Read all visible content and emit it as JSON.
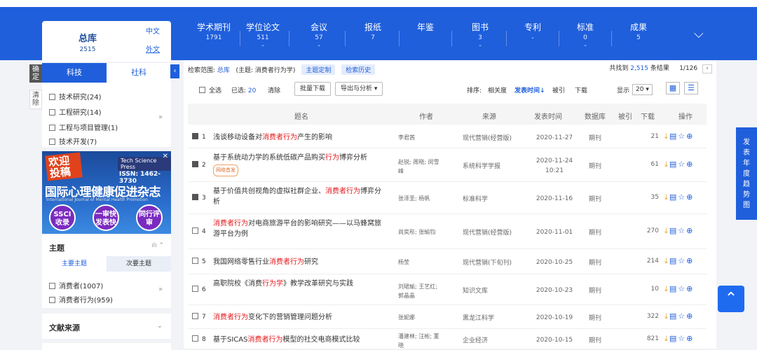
{
  "left_toggle": [
    "确定",
    "清除"
  ],
  "library": {
    "title": "总库",
    "count": "2515",
    "lang_zh": "中文",
    "lang_en": "外文"
  },
  "nav_tabs": [
    {
      "label": "学术期刊",
      "count": "1791",
      "caret": ""
    },
    {
      "label": "学位论文",
      "count": "511",
      "caret": "⌄"
    },
    {
      "label": "会议",
      "count": "57",
      "caret": "⌄"
    },
    {
      "label": "报纸",
      "count": "7",
      "caret": ""
    },
    {
      "label": "年鉴",
      "count": "",
      "caret": ""
    },
    {
      "label": "图书",
      "count": "3",
      "caret": "⌄"
    },
    {
      "label": "专利",
      "count": "",
      "caret": "⌄"
    },
    {
      "label": "标准",
      "count": "0",
      "caret": "⌄"
    },
    {
      "label": "成果",
      "count": "5",
      "caret": ""
    }
  ],
  "filter": {
    "tab_active": "科技",
    "tab_inactive": "社科",
    "items": [
      "技术研究(24)",
      "工程研究(14)",
      "工程与项目管理(1)",
      "技术开发(7)"
    ]
  },
  "ad": {
    "line1": "欢迎投稿",
    "press": "Tech Science Press",
    "issn": "ISSN: 1462-3730",
    "title": "国际心理健康促进杂志",
    "subtitle": "International Journal of Mental Health Promotion",
    "badges": [
      "SSCI收录",
      "一审快发表快",
      "同行评审"
    ]
  },
  "subject": {
    "heading": "主题",
    "tab_main": "主要主题",
    "tab_sub": "次要主题",
    "items": [
      "消费者(1007)",
      "消费者行为(959)"
    ]
  },
  "source": {
    "heading": "文献来源"
  },
  "scope": {
    "label": "检索范围:",
    "db": "总库",
    "query": "(主题: 消费者行为学)",
    "custom": "主题定制",
    "history": "检索历史"
  },
  "found": {
    "prefix": "共找到",
    "count": "2,515",
    "suffix": "条结果",
    "page": "1/126"
  },
  "toolbar": {
    "select_all": "全选",
    "selected_label": "已选:",
    "selected_count": "20",
    "clear": "清除",
    "batch": "批量下载",
    "export": "导出与分析 ▾",
    "sort_label": "排序:",
    "sort_rel": "相关度",
    "sort_time": "发表时间↓",
    "sort_cite": "被引",
    "sort_dl": "下载",
    "show_label": "显示",
    "show_value": "20 ▾"
  },
  "headers": {
    "title": "题名",
    "author": "作者",
    "source": "来源",
    "date": "发表时间",
    "db": "数据库",
    "cite": "被引",
    "dl": "下载",
    "ops": "操作"
  },
  "rows": [
    {
      "num": "1",
      "checked": true,
      "t1": "浅谈移动设备对",
      "hl": "消费者行为",
      "t2": "产生的影响",
      "tag": "",
      "author": "李君茜",
      "source": "现代营销(经营版)",
      "date": "2020-11-27",
      "db": "期刊",
      "dl": "21"
    },
    {
      "num": "2",
      "checked": true,
      "t1": "基于系统动力学的系统低碳产品购买",
      "hl": "行为",
      "t2": "博弈分析",
      "tag": "网络首发",
      "author": "赵锐; 周晓; 闵雪峰",
      "source": "系统科学学报",
      "date": "2020-11-24 10:21",
      "db": "期刊",
      "dl": "61"
    },
    {
      "num": "3",
      "checked": true,
      "t1": "基于价值共创视角的虚拟社群企业、",
      "hl": "消费者行为",
      "t2": "博弈分析",
      "tag": "",
      "author": "张泽圣; 杨帆",
      "source": "标准科学",
      "date": "2020-11-16",
      "db": "期刊",
      "dl": "35"
    },
    {
      "num": "4",
      "checked": false,
      "t1": "",
      "hl": "消费者行为",
      "t2": "对电商旅游平台的影响研究——以马蜂窝旅游平台为例",
      "tag": "",
      "author": "尚奕彤; 张瑜钧",
      "source": "现代营销(经营版)",
      "date": "2020-11-01",
      "db": "期刊",
      "dl": "270"
    },
    {
      "num": "5",
      "checked": false,
      "t1": "我国网络零售行业",
      "hl": "消费者行为",
      "t2": "研究",
      "tag": "",
      "author": "杨莹",
      "source": "现代营销(下旬刊)",
      "date": "2020-10-25",
      "db": "期刊",
      "dl": "214"
    },
    {
      "num": "6",
      "checked": false,
      "t1": "高职院校《消费",
      "hl": "行为学",
      "t2": "》教学改革研究与实践",
      "tag": "",
      "author": "刘珺瑜; 王艺红; 郭晶晶",
      "source": "知识文库",
      "date": "2020-10-23",
      "db": "期刊",
      "dl": "10"
    },
    {
      "num": "7",
      "checked": false,
      "t1": "",
      "hl": "消费者行为",
      "t2": "变化下的营销管理问题分析",
      "tag": "",
      "author": "张妮娜",
      "source": "黑龙江科学",
      "date": "2020-10-19",
      "db": "期刊",
      "dl": "322"
    },
    {
      "num": "8",
      "checked": false,
      "t1": "基于SICAS",
      "hl": "消费者行为",
      "t2": "模型的社交电商模式比较",
      "tag": "",
      "author": "潘建林; 汪彬; 董晓",
      "source": "企业经济",
      "date": "2020-10-15",
      "db": "期刊",
      "dl": "821"
    }
  ],
  "right_panel": "发表年度趋势图",
  "to_top": "^"
}
